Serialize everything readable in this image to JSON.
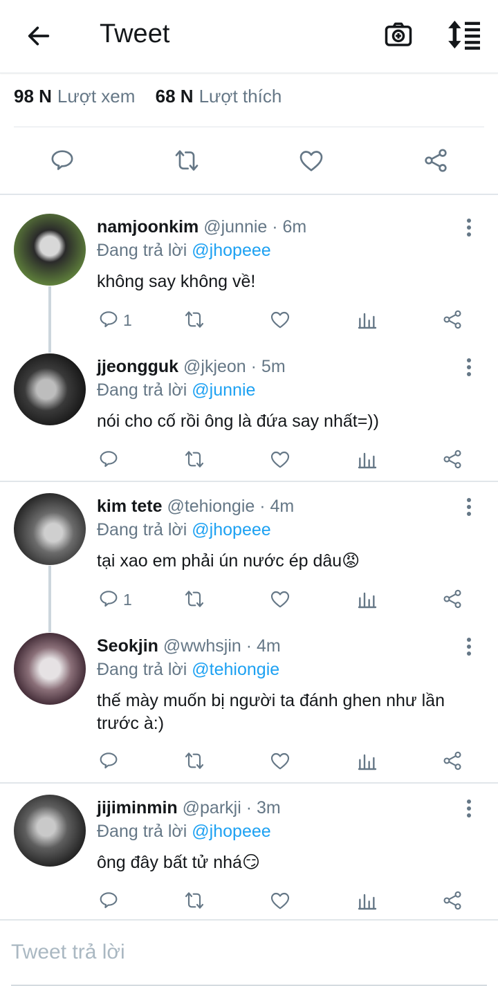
{
  "header": {
    "title": "Tweet",
    "back_icon": "arrow-left-icon",
    "camera_icon": "camera-plus-icon",
    "sort_icon": "sort-list-icon"
  },
  "stats": {
    "views_count": "98 N",
    "views_label": "Lượt xem",
    "likes_count": "68 N",
    "likes_label": "Lượt thích"
  },
  "tweets": [
    {
      "name": "namjoonkim",
      "handle": "@junnie · 6m",
      "replying_label": "Đang trả lời",
      "mention": "@jhopeee",
      "text": "không say không về!",
      "reply_count": "1"
    },
    {
      "name": "jjeongguk",
      "handle": "@jkjeon · 5m",
      "replying_label": "Đang trả lời",
      "mention": "@junnie",
      "text": "nói cho cố rồi ông là đứa say nhất=))",
      "reply_count": ""
    },
    {
      "name": "kim tete",
      "handle": "@tehiongie · 4m",
      "replying_label": "Đang trả lời",
      "mention": "@jhopeee",
      "text": "tại xao em phải ún nước ép dâu😡",
      "reply_count": "1"
    },
    {
      "name": "Seokjin",
      "handle": "@wwhsjin · 4m",
      "replying_label": "Đang trả lời",
      "mention": "@tehiongie",
      "text": "thế mày muốn bị người ta đánh ghen như lần trước à:)",
      "reply_count": ""
    },
    {
      "name": "jijiminmin",
      "handle": "@parkji · 3m",
      "replying_label": "Đang trả lời",
      "mention": "@jhopeee",
      "text": "ông đây bất tử nhá😏",
      "reply_count": ""
    }
  ],
  "compose": {
    "placeholder": "Tweet trả lời"
  },
  "colors": {
    "accent": "#1da1f2",
    "muted": "#657786",
    "divider": "#e1e6ea",
    "text": "#14171a"
  }
}
